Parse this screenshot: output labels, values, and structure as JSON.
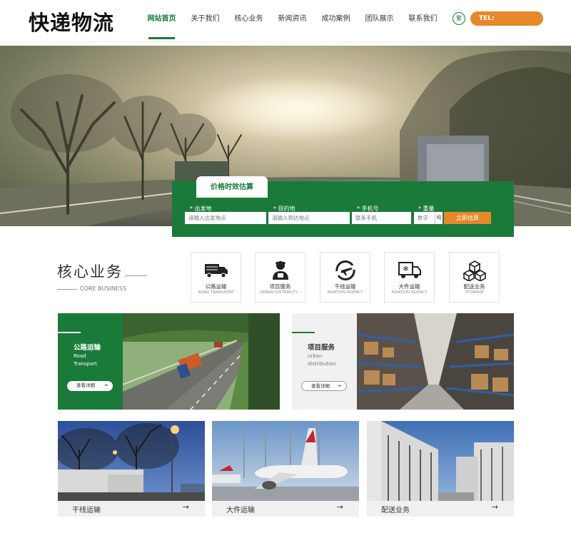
{
  "header": {
    "logo": "快递物流",
    "nav": [
      "网站首页",
      "关于我们",
      "核心业务",
      "新闻资讯",
      "成功案例",
      "团队展示",
      "联系我们"
    ],
    "active_index": 0,
    "lang_button": "繁",
    "tel_label": "TEL:"
  },
  "estimate": {
    "tab_label": "价格时效估算",
    "fields": [
      {
        "label": "* 出发地",
        "placeholder": "请输入出发地点"
      },
      {
        "label": "* 目的地",
        "placeholder": "请输入到达地点"
      },
      {
        "label": "* 手机号",
        "placeholder": "联系手机"
      },
      {
        "label": "* 重量",
        "placeholder": "数字"
      }
    ],
    "unit": "吨",
    "submit_label": "立即估算"
  },
  "core": {
    "title": "核心业务",
    "subtitle": "CORE BUSINESS",
    "services": [
      {
        "name": "公路运输",
        "en": "ROAD TRANSPORT",
        "icon": "truck-icon"
      },
      {
        "name": "项目服务",
        "en": "URBAN DISTRIBUTI...",
        "icon": "courier-person-icon"
      },
      {
        "name": "干线运输",
        "en": "AVIATION AGENCY",
        "icon": "plane-cycle-icon"
      },
      {
        "name": "大件运输",
        "en": "AVIATION AGENCY",
        "icon": "refrigerated-truck-icon"
      },
      {
        "name": "配送业务",
        "en": "STORAGE",
        "icon": "boxes-icon"
      }
    ]
  },
  "features": [
    {
      "title": "公路运输",
      "en": [
        "Road",
        "Transport"
      ],
      "button": "查看详细",
      "arrow": "→"
    },
    {
      "title": "项目服务",
      "en": [
        "urban",
        "distribution"
      ],
      "button": "查看详细",
      "arrow": "→"
    }
  ],
  "cards": [
    {
      "title": "干线运输",
      "arrow": "→"
    },
    {
      "title": "大件运输",
      "arrow": "→"
    },
    {
      "title": "配送业务",
      "arrow": "→"
    }
  ],
  "colors": {
    "brand_green": "#1a7a3a",
    "accent_orange": "#e5882a"
  }
}
